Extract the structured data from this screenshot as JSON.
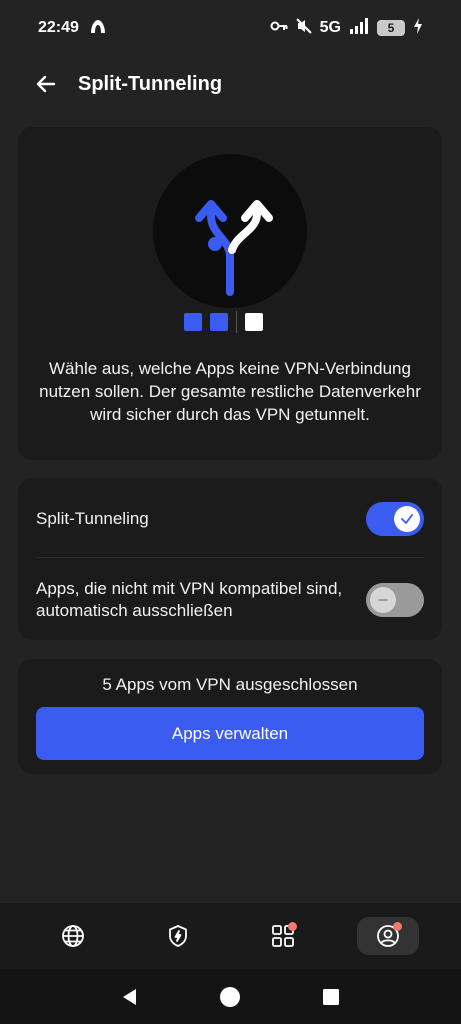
{
  "status_bar": {
    "time": "22:49",
    "network": "5G",
    "battery": "5"
  },
  "app_bar": {
    "title": "Split-Tunneling"
  },
  "hero": {
    "description": "Wähle aus, welche Apps keine VPN-Verbindung nutzen sollen. Der gesamte restliche Datenverkehr wird sicher durch das VPN getunnelt.",
    "pager_colors": [
      "#3b5cf0",
      "#3b5cf0",
      "#ffffff"
    ]
  },
  "settings": {
    "split_tunneling": {
      "label": "Split-Tunneling",
      "enabled": true
    },
    "auto_exclude": {
      "label": "Apps, die nicht mit VPN kompatibel sind, automatisch ausschließen",
      "enabled": false
    }
  },
  "apps_section": {
    "count_text": "5 Apps vom VPN ausgeschlossen",
    "button_label": "Apps verwalten"
  },
  "bottom_nav": {
    "items": [
      {
        "icon": "globe-icon"
      },
      {
        "icon": "shield-bolt-icon"
      },
      {
        "icon": "apps-grid-icon",
        "badge": true
      },
      {
        "icon": "profile-icon",
        "badge": true,
        "active": true
      }
    ]
  },
  "colors": {
    "accent": "#3b5cf0",
    "background": "#232323",
    "card": "#1b1b1b",
    "badge": "#f17a72"
  }
}
